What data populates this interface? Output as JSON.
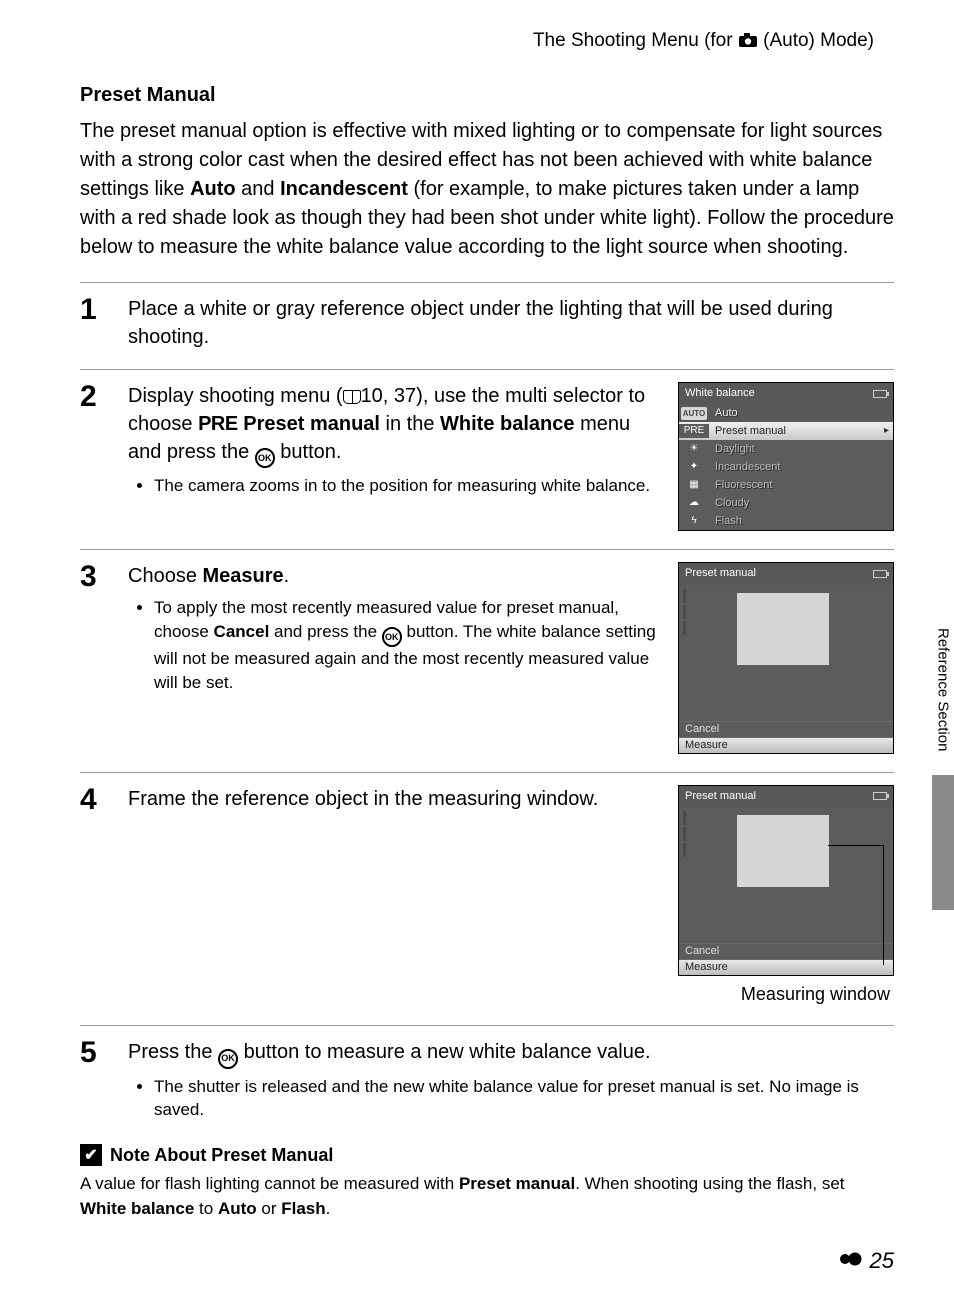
{
  "header": {
    "text_before": "The Shooting Menu (for ",
    "text_after": " (Auto) Mode)",
    "icon": "camera-icon"
  },
  "section": {
    "title": "Preset Manual",
    "intro_parts": [
      "The preset manual option is effective with mixed lighting or to compensate for light sources with a strong color cast when the desired effect has not been achieved with white balance settings like ",
      "Auto",
      " and ",
      "Incandescent",
      " (for example, to make pictures taken under a lamp with a red shade look as though they had been shot under white light). Follow the procedure below to measure the white balance value according to the light source when shooting."
    ]
  },
  "steps": [
    {
      "num": "1",
      "main": "Place a white or gray reference object under the lighting that will be used during shooting."
    },
    {
      "num": "2",
      "main_before_book": "Display shooting menu (",
      "main_refs": "10, 37",
      "main_after_refs": "), use the multi selector to choose ",
      "pre_label": "PRE",
      "main_mid_bold": "Preset manual",
      "main_after_mid": " in the ",
      "wb_bold": "White balance",
      "main_after_wb": " menu and press the ",
      "main_after_ok": " button.",
      "bullet": "The camera zooms in to the position for measuring white balance."
    },
    {
      "num": "3",
      "main_before_bold": "Choose ",
      "measure_bold": "Measure",
      "main_after_bold": ".",
      "bullet_before": "To apply the most recently measured value for preset manual, choose ",
      "cancel_bold": "Cancel",
      "bullet_mid": " and press the ",
      "bullet_after": " button. The white balance setting will not be measured again and the most recently measured value will be set."
    },
    {
      "num": "4",
      "main": "Frame the reference object in the measuring window.",
      "caption": "Measuring window"
    },
    {
      "num": "5",
      "main_before_ok": "Press the ",
      "main_after_ok": " button to measure a new white balance value.",
      "bullet": "The shutter is released and the new white balance value for preset manual is set. No image is saved."
    }
  ],
  "lcd_wb": {
    "title": "White balance",
    "items": [
      {
        "icon": "AUTO",
        "label": "Auto",
        "kind": "top"
      },
      {
        "icon": "PRE",
        "label": "Preset manual",
        "kind": "sel"
      },
      {
        "icon": "☀",
        "label": "Daylight"
      },
      {
        "icon": "✦",
        "label": "Incandescent"
      },
      {
        "icon": "▦",
        "label": "Fluorescent"
      },
      {
        "icon": "☁",
        "label": "Cloudy"
      },
      {
        "icon": "ϟ",
        "label": "Flash"
      }
    ]
  },
  "lcd_pm": {
    "title": "Preset manual",
    "cancel": "Cancel",
    "measure": "Measure"
  },
  "note": {
    "title": "Note About Preset Manual",
    "body_before": "A value for flash lighting cannot be measured with ",
    "pm_bold": "Preset manual",
    "body_mid1": ". When shooting using the flash, set ",
    "wb_bold": "White balance",
    "body_mid2": " to ",
    "auto_bold": "Auto",
    "body_mid3": " or ",
    "flash_bold": "Flash",
    "body_end": "."
  },
  "side_label": "Reference Section",
  "page_number": "25",
  "ok_label": "OK"
}
